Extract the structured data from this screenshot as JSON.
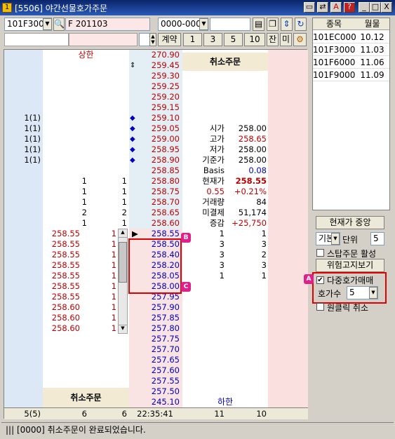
{
  "window": {
    "title": "[5506] 야간선물호가주문",
    "min": "_",
    "max": "□",
    "close": "X",
    "help": "?"
  },
  "toolbar": {
    "code": "101F3000",
    "name": "F 201103",
    "account": "0000-0000",
    "qty": "1",
    "contract_label": "계약",
    "qty_buttons": [
      "1",
      "3",
      "5",
      "10"
    ],
    "jan": "잔",
    "mi": "미"
  },
  "side_table": {
    "headers": [
      "종목",
      "월물"
    ],
    "rows": [
      [
        "101EC000",
        "10.12"
      ],
      [
        "101F3000",
        "11.03"
      ],
      [
        "101F6000",
        "11.06"
      ],
      [
        "101F9000",
        "11.09"
      ]
    ]
  },
  "controls": {
    "center_btn": "현재가 중앙",
    "basic": "기본",
    "unit_label": "단위",
    "unit_val": "5",
    "stop_order": "스탑주문 활성",
    "risk_btn": "위험고지보기",
    "multi_hoga": "다중호가매매",
    "hoga_count_label": "호가수",
    "hoga_count": "5",
    "one_click": "원클릭 취소"
  },
  "ladder": {
    "upper_limit": "상한",
    "lower_limit": "하한",
    "cancel_top": "취소주문",
    "cancel_bottom": "취소주문",
    "prices_ask": [
      "270.90",
      "259.45",
      "259.30",
      "259.25",
      "259.20",
      "259.15",
      "259.10",
      "259.05",
      "259.00",
      "258.95",
      "258.90",
      "258.85",
      "258.80",
      "258.75",
      "258.70",
      "258.65",
      "258.60"
    ],
    "prices_bid": [
      "258.55",
      "258.50",
      "258.40",
      "258.20",
      "258.05",
      "258.00",
      "257.95",
      "257.90",
      "257.85",
      "257.80",
      "257.75",
      "257.70",
      "257.65",
      "257.60",
      "257.55",
      "257.50",
      "245.10"
    ],
    "sell_orders": [
      "",
      "",
      "",
      "",
      "",
      "",
      "1(1)",
      "1(1)",
      "1(1)",
      "1(1)",
      "1(1)",
      "",
      "",
      "",
      "",
      "",
      ""
    ],
    "ask_qty": [
      "",
      "",
      "",
      "",
      "",
      "",
      "",
      "",
      "",
      "",
      "",
      "",
      "1",
      "1",
      "1",
      "2",
      "1"
    ],
    "ask_cnt": [
      "",
      "",
      "",
      "",
      "",
      "",
      "",
      "",
      "",
      "",
      "",
      "",
      "1",
      "1",
      "1",
      "2",
      "1"
    ],
    "bid_order_price": [
      "258.55",
      "258.55",
      "258.55",
      "258.55",
      "258.55",
      "258.55",
      "258.55",
      "258.60",
      "258.60",
      "258.60"
    ],
    "bid_order_qty": [
      "1",
      "1",
      "1",
      "1",
      "1",
      "1",
      "1",
      "1",
      "1",
      "1"
    ],
    "bid_qty": [
      "1",
      "3",
      "3",
      "3",
      "1"
    ],
    "bid_cnt": [
      "1",
      "3",
      "2",
      "3",
      "1"
    ],
    "info": [
      [
        "시가",
        "258.00"
      ],
      [
        "고가",
        "258.65"
      ],
      [
        "저가",
        "258.00"
      ],
      [
        "기준가",
        "258.00"
      ],
      [
        "Basis",
        "0.08"
      ],
      [
        "현재가",
        "258.55"
      ],
      [
        "0.55",
        "+0.21%"
      ],
      [
        "거래량",
        "84"
      ],
      [
        "미결제",
        "51,174"
      ],
      [
        "증감",
        "+25,750"
      ]
    ],
    "footer": [
      "5(5)",
      "6",
      "6",
      "22:35:41",
      "11",
      "10"
    ]
  },
  "badges": {
    "a": "A",
    "b": "B",
    "c": "C"
  },
  "status": "||| [0000] 취소주문이 완료되었습니다."
}
